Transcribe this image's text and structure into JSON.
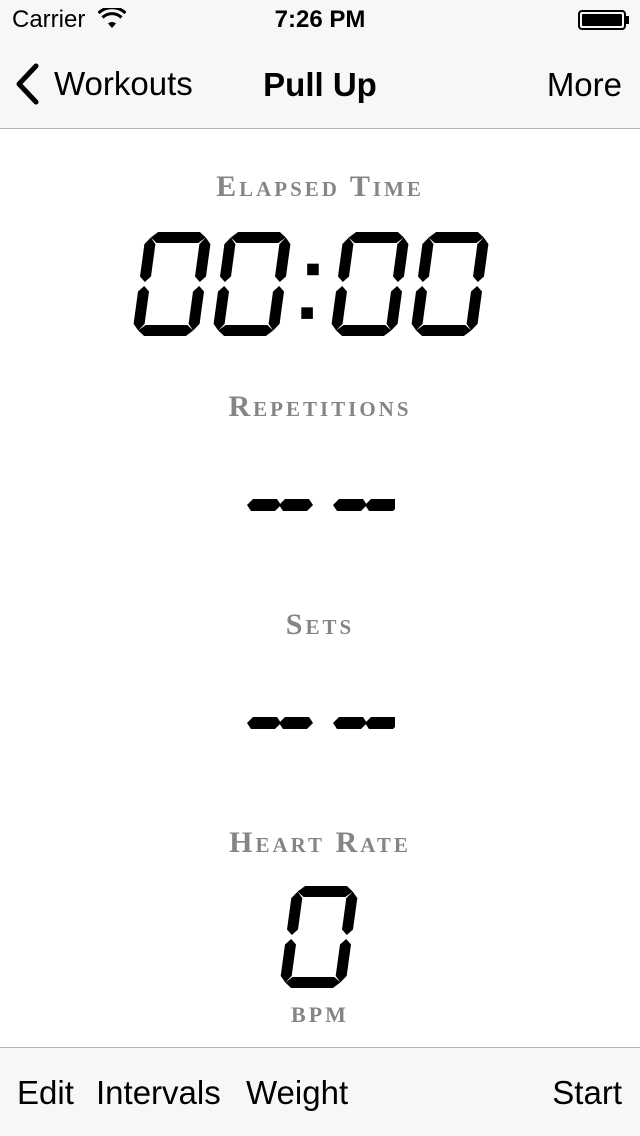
{
  "status_bar": {
    "carrier": "Carrier",
    "time": "7:26 PM"
  },
  "nav": {
    "back_label": "Workouts",
    "title": "Pull Up",
    "more_label": "More"
  },
  "metrics": {
    "elapsed_label": "Elapsed Time",
    "elapsed_value": "00:00",
    "reps_label": "Repetitions",
    "reps_value": "-- --",
    "sets_label": "Sets",
    "sets_value": "-- --",
    "heart_label": "Heart Rate",
    "heart_value": "0",
    "heart_unit": "BPM"
  },
  "toolbar": {
    "edit_label": "Edit",
    "intervals_label": "Intervals",
    "weight_label": "Weight",
    "start_label": "Start"
  },
  "icons": {
    "wifi": "wifi-icon",
    "battery": "battery-icon",
    "back": "chevron-left-icon"
  },
  "colors": {
    "label_gray": "#858585",
    "bar_bg": "#f7f7f7",
    "lcd": "#000000"
  }
}
